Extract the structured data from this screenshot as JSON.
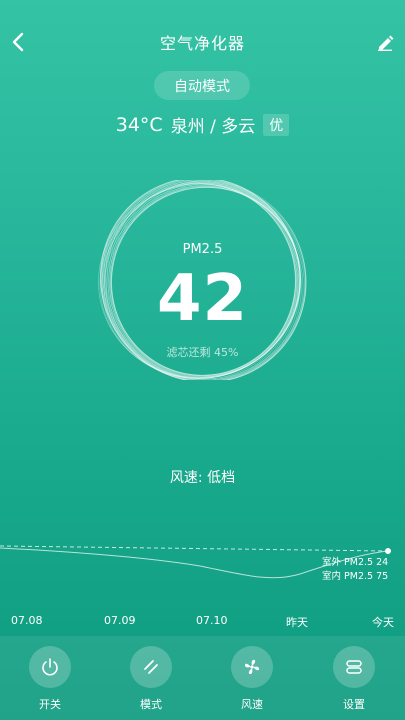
{
  "header": {
    "title": "空气净化器",
    "back_icon": "chevron-left-icon",
    "edit_icon": "pencil-icon"
  },
  "mode": {
    "label": "自动模式"
  },
  "weather": {
    "temperature": "34°C",
    "location": "泉州 / 多云",
    "quality": "优"
  },
  "pm": {
    "label": "PM2.5",
    "value": "42",
    "filter_text": "滤芯还剩 45%"
  },
  "wind": {
    "text": "风速: 低档"
  },
  "trend": {
    "outdoor_label": "室外 PM2.5 24",
    "indoor_label": "室内 PM2.5 75",
    "dates": [
      "07.08",
      "07.09",
      "07.10",
      "昨天",
      "今天"
    ]
  },
  "controls": [
    {
      "label": "开关",
      "icon": "power-icon"
    },
    {
      "label": "模式",
      "icon": "mode-icon"
    },
    {
      "label": "风速",
      "icon": "fan-icon"
    },
    {
      "label": "设置",
      "icon": "settings-icon"
    }
  ]
}
